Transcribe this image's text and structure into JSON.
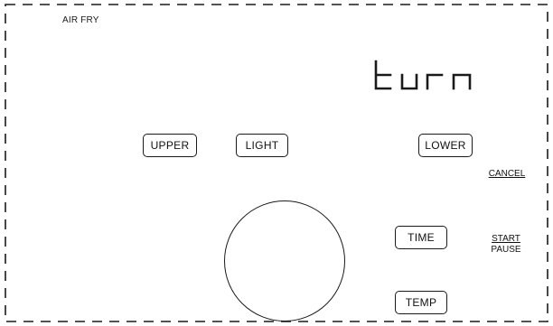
{
  "panel": {
    "mode_label": "AIR FRY"
  },
  "display": {
    "text": "turn"
  },
  "buttons": {
    "upper": "UPPER",
    "light": "LIGHT",
    "lower": "LOWER",
    "time": "TIME",
    "temp": "TEMP"
  },
  "text_keys": {
    "cancel": "CANCEL",
    "start": "START",
    "pause": "PAUSE"
  },
  "icons": {
    "dial": "dial-knob-icon"
  }
}
